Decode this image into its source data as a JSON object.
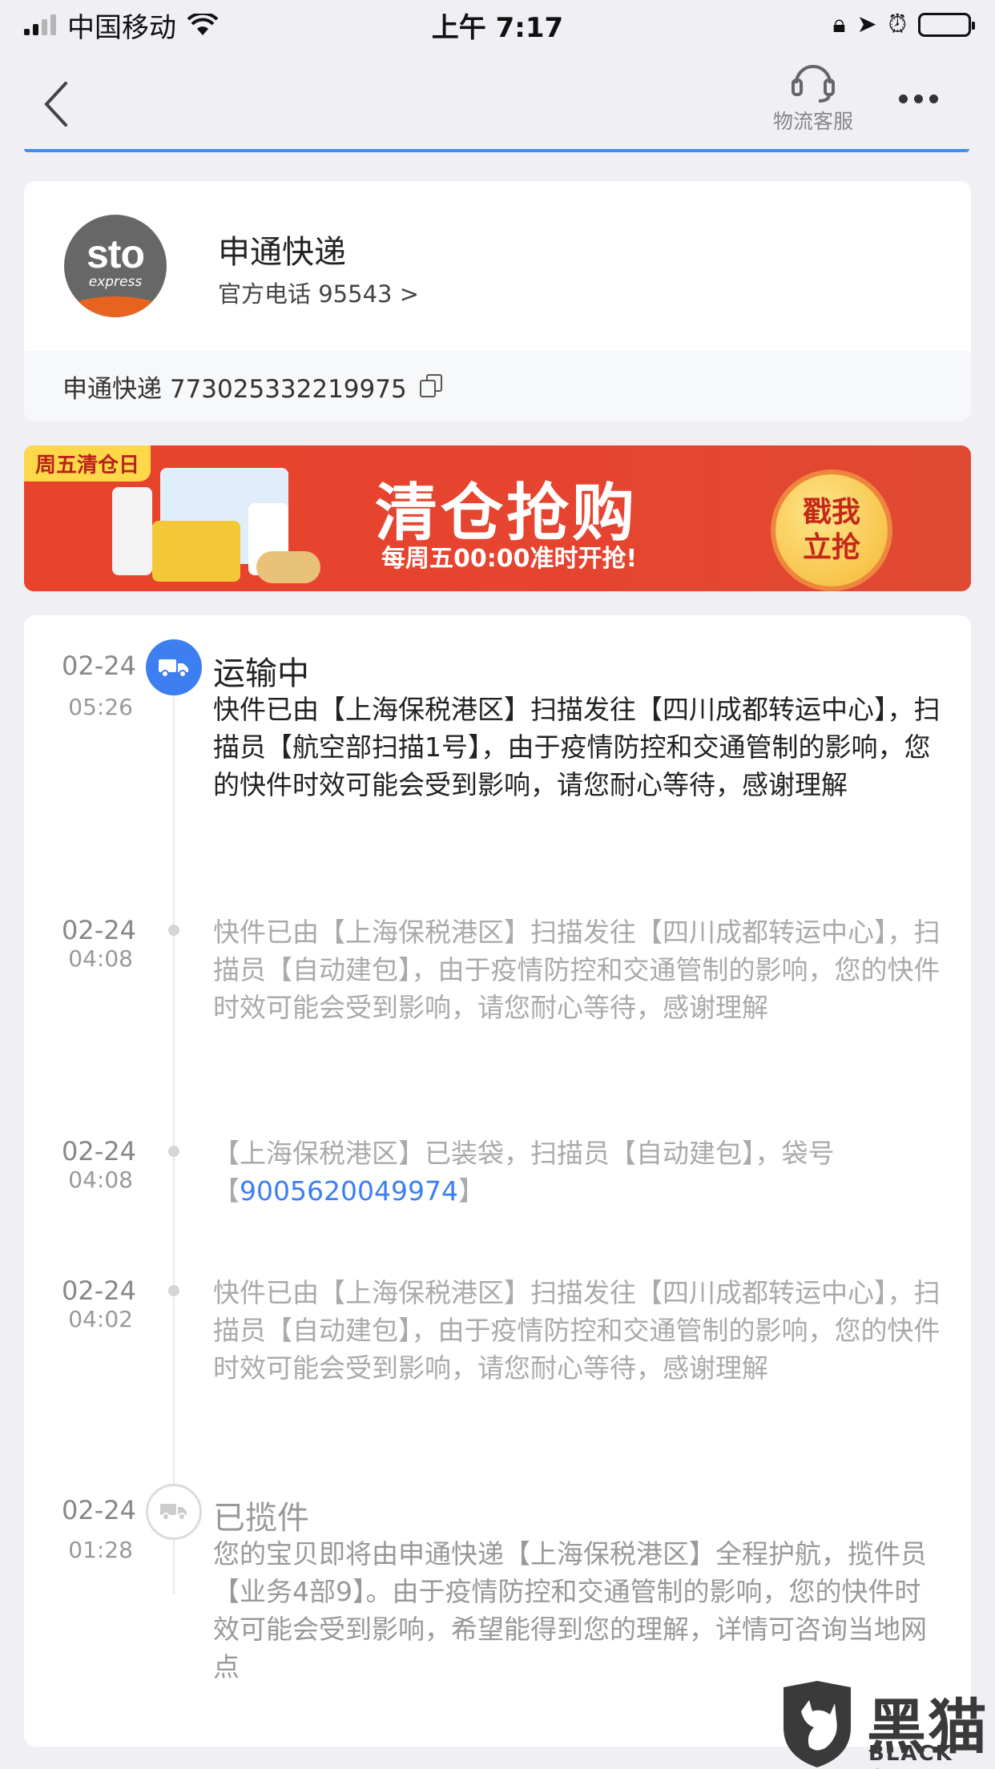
{
  "status_bar": {
    "carrier": "中国移动",
    "time": "上午 7:17",
    "icons": [
      "signal-icon",
      "wifi-icon",
      "orientation-lock-icon",
      "location-icon",
      "alarm-icon",
      "battery-icon"
    ]
  },
  "nav": {
    "back_icon": "chevron-left-icon",
    "customer_service_label": "物流客服",
    "customer_service_icon": "headset-icon",
    "more_icon": "more-dots-icon",
    "accent_color": "#3d8ff0"
  },
  "carrier": {
    "logo_text": "sto",
    "logo_sub": "express",
    "name": "申通快递",
    "phone": "官方电话 95543 >",
    "tracking": "申通快递 773025332219975",
    "copy_icon": "copy-icon"
  },
  "banner": {
    "tag": "周五清仓日",
    "title": "清仓抢购",
    "subtitle": "每周五00:00准时开抢!",
    "cta": "戳我立抢",
    "bg_color": "#e8432b"
  },
  "timeline": [
    {
      "date": "02-24",
      "time": "05:26",
      "status": "运输中",
      "desc": "快件已由【上海保税港区】扫描发往【四川成都转运中心】，扫描员【航空部扫描1号】，由于疫情防控和交通管制的影响，您的快件时效可能会受到影响，请您耐心等待，感谢理解"
    },
    {
      "date": "02-24",
      "time": "04:08",
      "desc": "快件已由【上海保税港区】扫描发往【四川成都转运中心】，扫描员【自动建包】，由于疫情防控和交通管制的影响，您的快件时效可能会受到影响，请您耐心等待，感谢理解"
    },
    {
      "date": "02-24",
      "time": "04:08",
      "desc_before": "【上海保税港区】已装袋，扫描员【自动建包】，袋号【",
      "link": "9005620049974",
      "desc_after": "】"
    },
    {
      "date": "02-24",
      "time": "04:02",
      "desc": "快件已由【上海保税港区】扫描发往【四川成都转运中心】，扫描员【自动建包】，由于疫情防控和交通管制的影响，您的快件时效可能会受到影响，请您耐心等待，感谢理解"
    },
    {
      "date": "02-24",
      "time": "01:28",
      "status": "已揽件",
      "desc": "您的宝贝即将由申通快递【上海保税港区】全程护航，揽件员【业务4部9】。由于疫情防控和交通管制的影响，您的快件时效可能会受到影响，希望能得到您的理解，详情可咨询当地网点"
    }
  ],
  "watermark": {
    "big": "黑猫",
    "small": "BLACK CAT"
  }
}
